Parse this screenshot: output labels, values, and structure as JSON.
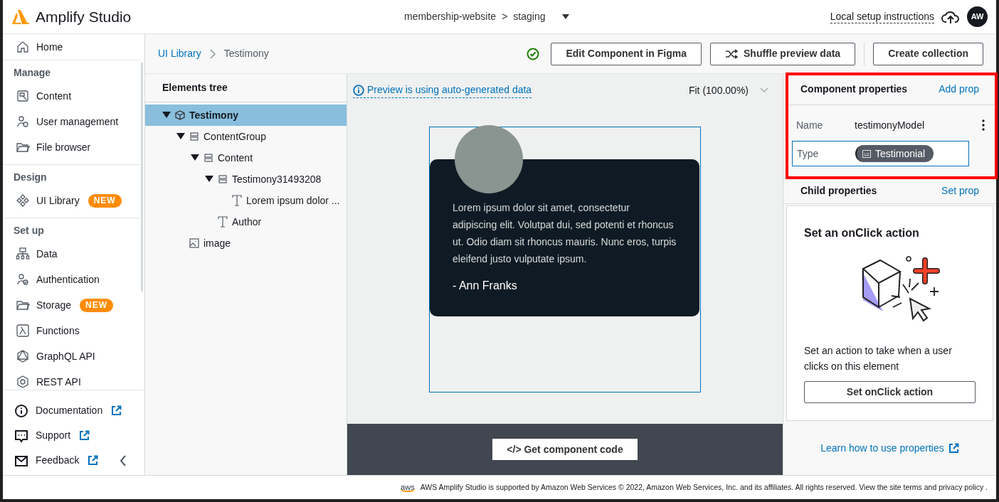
{
  "app": {
    "title": "Amplify Studio"
  },
  "header": {
    "project": "membership-website",
    "separator": ">",
    "environment": "staging",
    "setup_link": "Local setup instructions",
    "avatar": "AW"
  },
  "sidebar": {
    "home": "Home",
    "sections": [
      {
        "title": "Manage",
        "items": [
          {
            "label": "Content",
            "kind": "content"
          },
          {
            "label": "User management",
            "kind": "users"
          },
          {
            "label": "File browser",
            "kind": "folder"
          }
        ]
      },
      {
        "title": "Design",
        "items": [
          {
            "label": "UI Library",
            "kind": "library",
            "badge": "NEW"
          }
        ]
      },
      {
        "title": "Set up",
        "items": [
          {
            "label": "Data",
            "kind": "data"
          },
          {
            "label": "Authentication",
            "kind": "auth"
          },
          {
            "label": "Storage",
            "kind": "folder",
            "badge": "NEW"
          },
          {
            "label": "Functions",
            "kind": "lambda"
          },
          {
            "label": "GraphQL API",
            "kind": "graphql"
          },
          {
            "label": "REST API",
            "kind": "rest"
          }
        ]
      }
    ],
    "links": [
      {
        "label": "Documentation",
        "kind": "info"
      },
      {
        "label": "Support",
        "kind": "chat"
      },
      {
        "label": "Feedback",
        "kind": "mail"
      }
    ]
  },
  "breadcrumb": [
    {
      "label": "UI Library",
      "kind": "link"
    },
    {
      "label": "Testimony",
      "kind": "current"
    }
  ],
  "toolbar": {
    "buttons": [
      {
        "label": "Edit Component in Figma",
        "kind": "plain"
      },
      {
        "label": "Shuffle preview data",
        "kind": "shuffle"
      },
      {
        "label": "Create collection",
        "kind": "plain"
      }
    ]
  },
  "tree": {
    "title": "Elements tree",
    "nodes": [
      {
        "label": "Testimony",
        "kind": "component",
        "selected": true,
        "children": [
          {
            "label": "ContentGroup",
            "kind": "group",
            "selected": false,
            "children": [
              {
                "label": "Content",
                "kind": "group",
                "selected": false,
                "children": [
                  {
                    "label": "Testimony31493208",
                    "kind": "group",
                    "selected": false,
                    "children": [
                      {
                        "label": "Lorem ipsum dolor ...",
                        "kind": "text",
                        "selected": false
                      }
                    ]
                  },
                  {
                    "label": "Author",
                    "kind": "text",
                    "selected": false
                  }
                ]
              }
            ]
          },
          {
            "label": "image",
            "kind": "image",
            "selected": false
          }
        ]
      }
    ]
  },
  "preview": {
    "notice": "Preview is using auto-generated data",
    "zoom": "Fit (100.00%)",
    "quote": "Lorem ipsum dolor sit amet, consectetur adipiscing elit. Volutpat dui, sed potenti et rhoncus ut. Odio diam sit rhoncus mauris. Nunc eros, turpis eleifend justo vulputate ipsum.",
    "author": "- Ann Franks",
    "code_button": "</> Get component code"
  },
  "properties": {
    "title": "Component properties",
    "add": "Add prop",
    "rows": [
      {
        "label": "Name",
        "value": "testimonyModel",
        "kind": "text"
      },
      {
        "label": "Type",
        "value": "Testimonial",
        "kind": "chip"
      }
    ],
    "child_title": "Child properties",
    "child_add": "Set prop",
    "card": {
      "title": "Set an onClick action",
      "text": "Set an action to take when a user clicks on this element",
      "button": "Set onClick action"
    },
    "learn": "Learn how to use properties"
  },
  "footer": {
    "logo": "aws",
    "text": "AWS Amplify Studio is supported by Amazon Web Services © 2022, Amazon Web Services, Inc. and its affiliates. All rights reserved. View the site terms and privacy policy ."
  }
}
